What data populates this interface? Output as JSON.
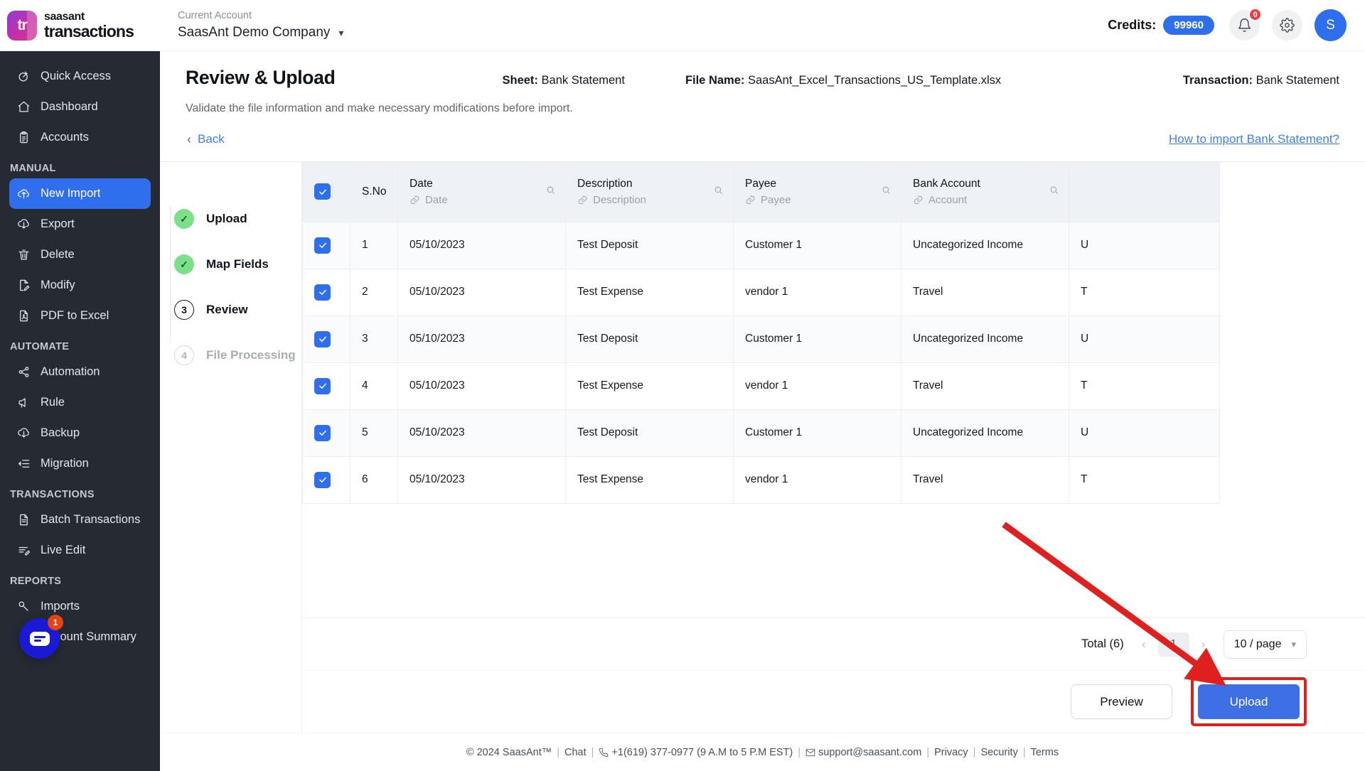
{
  "header": {
    "brand_top": "saasant",
    "brand_bottom": "transactions",
    "logo_text": "tr",
    "account_label": "Current Account",
    "account_name": "SaasAnt Demo Company",
    "credits_label": "Credits:",
    "credits_value": "99960",
    "notifications_count": "0",
    "avatar_initial": "S",
    "accent_color": "#2f6fed"
  },
  "sidebar": {
    "items": [
      {
        "label": "Quick Access",
        "icon": "target-icon",
        "active": false
      },
      {
        "label": "Dashboard",
        "icon": "home-icon",
        "active": false
      },
      {
        "label": "Accounts",
        "icon": "clipboard-icon",
        "active": false
      }
    ],
    "sections": [
      {
        "title": "MANUAL",
        "items": [
          {
            "label": "New Import",
            "icon": "upload-cloud-icon",
            "active": true
          },
          {
            "label": "Export",
            "icon": "download-cloud-icon",
            "active": false
          },
          {
            "label": "Delete",
            "icon": "trash-icon",
            "active": false
          },
          {
            "label": "Modify",
            "icon": "file-edit-icon",
            "active": false
          },
          {
            "label": "PDF to Excel",
            "icon": "file-pdf-icon",
            "active": false
          }
        ]
      },
      {
        "title": "AUTOMATE",
        "items": [
          {
            "label": "Automation",
            "icon": "share-nodes-icon",
            "active": false
          },
          {
            "label": "Rule",
            "icon": "megaphone-icon",
            "active": false
          },
          {
            "label": "Backup",
            "icon": "download-cloud-icon",
            "active": false
          },
          {
            "label": "Migration",
            "icon": "list-arrow-icon",
            "active": false
          }
        ]
      },
      {
        "title": "TRANSACTIONS",
        "items": [
          {
            "label": "Batch Transactions",
            "icon": "file-icon",
            "active": false
          },
          {
            "label": "Live Edit",
            "icon": "file-pen-icon",
            "active": false
          }
        ]
      },
      {
        "title": "REPORTS",
        "items": [
          {
            "label": "Imports",
            "icon": "key-icon",
            "active": false
          },
          {
            "label": "Account Summary",
            "icon": "clipboard-icon",
            "active": false
          }
        ]
      }
    ],
    "chat": {
      "badge": "1",
      "icon": "chat-bubble-icon"
    }
  },
  "page": {
    "title": "Review & Upload",
    "sheet_label": "Sheet:",
    "sheet_value": "Bank Statement",
    "file_label": "File Name:",
    "file_value": "SaasAnt_Excel_Transactions_US_Template.xlsx",
    "transaction_label": "Transaction:",
    "transaction_value": "Bank Statement",
    "subtitle": "Validate the file information and make necessary modifications before import.",
    "back_label": "Back",
    "how_link": "How to import Bank Statement?"
  },
  "stepper": [
    {
      "label": "Upload",
      "state": "done",
      "marker": "✓"
    },
    {
      "label": "Map Fields",
      "state": "done",
      "marker": "✓"
    },
    {
      "label": "Review",
      "state": "current",
      "marker": "3"
    },
    {
      "label": "File Processing",
      "state": "todo",
      "marker": "4"
    }
  ],
  "table": {
    "columns": [
      {
        "name": "S.No",
        "mapped": "",
        "searchable": false
      },
      {
        "name": "Date",
        "mapped": "Date",
        "searchable": true
      },
      {
        "name": "Description",
        "mapped": "Description",
        "searchable": true
      },
      {
        "name": "Payee",
        "mapped": "Payee",
        "searchable": true
      },
      {
        "name": "Bank Account",
        "mapped": "Account",
        "searchable": true
      }
    ],
    "header_checked": true,
    "rows": [
      {
        "checked": true,
        "sno": "1",
        "date": "05/10/2023",
        "description": "Test Deposit",
        "payee": "Customer 1",
        "bank_account": "Uncategorized Income",
        "next": "U"
      },
      {
        "checked": true,
        "sno": "2",
        "date": "05/10/2023",
        "description": "Test Expense",
        "payee": "vendor 1",
        "bank_account": "Travel",
        "next": "T"
      },
      {
        "checked": true,
        "sno": "3",
        "date": "05/10/2023",
        "description": "Test Deposit",
        "payee": "Customer 1",
        "bank_account": "Uncategorized Income",
        "next": "U"
      },
      {
        "checked": true,
        "sno": "4",
        "date": "05/10/2023",
        "description": "Test Expense",
        "payee": "vendor 1",
        "bank_account": "Travel",
        "next": "T"
      },
      {
        "checked": true,
        "sno": "5",
        "date": "05/10/2023",
        "description": "Test Deposit",
        "payee": "Customer 1",
        "bank_account": "Uncategorized Income",
        "next": "U"
      },
      {
        "checked": true,
        "sno": "6",
        "date": "05/10/2023",
        "description": "Test Expense",
        "payee": "vendor 1",
        "bank_account": "Travel",
        "next": "T"
      }
    ]
  },
  "pagination": {
    "total": "Total (6)",
    "prev": "‹",
    "current_page": "1",
    "next": "›",
    "per_page": "10 / page"
  },
  "actions": {
    "preview": "Preview",
    "upload": "Upload",
    "highlight_color": "#e01f1f"
  },
  "footer": {
    "copyright": "© 2024 SaasAnt™",
    "chat": "Chat",
    "phone": "+1(619) 377-0977 (9 A.M to 5 P.M EST)",
    "email": "support@saasant.com",
    "privacy": "Privacy",
    "security": "Security",
    "terms": "Terms"
  }
}
